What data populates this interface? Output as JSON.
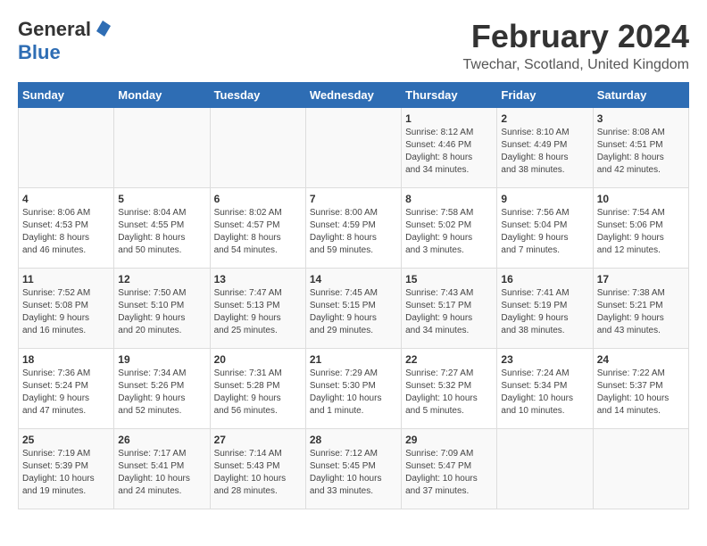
{
  "header": {
    "logo_line1": "General",
    "logo_line2": "Blue",
    "main_title": "February 2024",
    "subtitle": "Twechar, Scotland, United Kingdom"
  },
  "calendar": {
    "days_of_week": [
      "Sunday",
      "Monday",
      "Tuesday",
      "Wednesday",
      "Thursday",
      "Friday",
      "Saturday"
    ],
    "weeks": [
      [
        {
          "day": "",
          "content": ""
        },
        {
          "day": "",
          "content": ""
        },
        {
          "day": "",
          "content": ""
        },
        {
          "day": "",
          "content": ""
        },
        {
          "day": "1",
          "content": "Sunrise: 8:12 AM\nSunset: 4:46 PM\nDaylight: 8 hours\nand 34 minutes."
        },
        {
          "day": "2",
          "content": "Sunrise: 8:10 AM\nSunset: 4:49 PM\nDaylight: 8 hours\nand 38 minutes."
        },
        {
          "day": "3",
          "content": "Sunrise: 8:08 AM\nSunset: 4:51 PM\nDaylight: 8 hours\nand 42 minutes."
        }
      ],
      [
        {
          "day": "4",
          "content": "Sunrise: 8:06 AM\nSunset: 4:53 PM\nDaylight: 8 hours\nand 46 minutes."
        },
        {
          "day": "5",
          "content": "Sunrise: 8:04 AM\nSunset: 4:55 PM\nDaylight: 8 hours\nand 50 minutes."
        },
        {
          "day": "6",
          "content": "Sunrise: 8:02 AM\nSunset: 4:57 PM\nDaylight: 8 hours\nand 54 minutes."
        },
        {
          "day": "7",
          "content": "Sunrise: 8:00 AM\nSunset: 4:59 PM\nDaylight: 8 hours\nand 59 minutes."
        },
        {
          "day": "8",
          "content": "Sunrise: 7:58 AM\nSunset: 5:02 PM\nDaylight: 9 hours\nand 3 minutes."
        },
        {
          "day": "9",
          "content": "Sunrise: 7:56 AM\nSunset: 5:04 PM\nDaylight: 9 hours\nand 7 minutes."
        },
        {
          "day": "10",
          "content": "Sunrise: 7:54 AM\nSunset: 5:06 PM\nDaylight: 9 hours\nand 12 minutes."
        }
      ],
      [
        {
          "day": "11",
          "content": "Sunrise: 7:52 AM\nSunset: 5:08 PM\nDaylight: 9 hours\nand 16 minutes."
        },
        {
          "day": "12",
          "content": "Sunrise: 7:50 AM\nSunset: 5:10 PM\nDaylight: 9 hours\nand 20 minutes."
        },
        {
          "day": "13",
          "content": "Sunrise: 7:47 AM\nSunset: 5:13 PM\nDaylight: 9 hours\nand 25 minutes."
        },
        {
          "day": "14",
          "content": "Sunrise: 7:45 AM\nSunset: 5:15 PM\nDaylight: 9 hours\nand 29 minutes."
        },
        {
          "day": "15",
          "content": "Sunrise: 7:43 AM\nSunset: 5:17 PM\nDaylight: 9 hours\nand 34 minutes."
        },
        {
          "day": "16",
          "content": "Sunrise: 7:41 AM\nSunset: 5:19 PM\nDaylight: 9 hours\nand 38 minutes."
        },
        {
          "day": "17",
          "content": "Sunrise: 7:38 AM\nSunset: 5:21 PM\nDaylight: 9 hours\nand 43 minutes."
        }
      ],
      [
        {
          "day": "18",
          "content": "Sunrise: 7:36 AM\nSunset: 5:24 PM\nDaylight: 9 hours\nand 47 minutes."
        },
        {
          "day": "19",
          "content": "Sunrise: 7:34 AM\nSunset: 5:26 PM\nDaylight: 9 hours\nand 52 minutes."
        },
        {
          "day": "20",
          "content": "Sunrise: 7:31 AM\nSunset: 5:28 PM\nDaylight: 9 hours\nand 56 minutes."
        },
        {
          "day": "21",
          "content": "Sunrise: 7:29 AM\nSunset: 5:30 PM\nDaylight: 10 hours\nand 1 minute."
        },
        {
          "day": "22",
          "content": "Sunrise: 7:27 AM\nSunset: 5:32 PM\nDaylight: 10 hours\nand 5 minutes."
        },
        {
          "day": "23",
          "content": "Sunrise: 7:24 AM\nSunset: 5:34 PM\nDaylight: 10 hours\nand 10 minutes."
        },
        {
          "day": "24",
          "content": "Sunrise: 7:22 AM\nSunset: 5:37 PM\nDaylight: 10 hours\nand 14 minutes."
        }
      ],
      [
        {
          "day": "25",
          "content": "Sunrise: 7:19 AM\nSunset: 5:39 PM\nDaylight: 10 hours\nand 19 minutes."
        },
        {
          "day": "26",
          "content": "Sunrise: 7:17 AM\nSunset: 5:41 PM\nDaylight: 10 hours\nand 24 minutes."
        },
        {
          "day": "27",
          "content": "Sunrise: 7:14 AM\nSunset: 5:43 PM\nDaylight: 10 hours\nand 28 minutes."
        },
        {
          "day": "28",
          "content": "Sunrise: 7:12 AM\nSunset: 5:45 PM\nDaylight: 10 hours\nand 33 minutes."
        },
        {
          "day": "29",
          "content": "Sunrise: 7:09 AM\nSunset: 5:47 PM\nDaylight: 10 hours\nand 37 minutes."
        },
        {
          "day": "",
          "content": ""
        },
        {
          "day": "",
          "content": ""
        }
      ]
    ]
  }
}
